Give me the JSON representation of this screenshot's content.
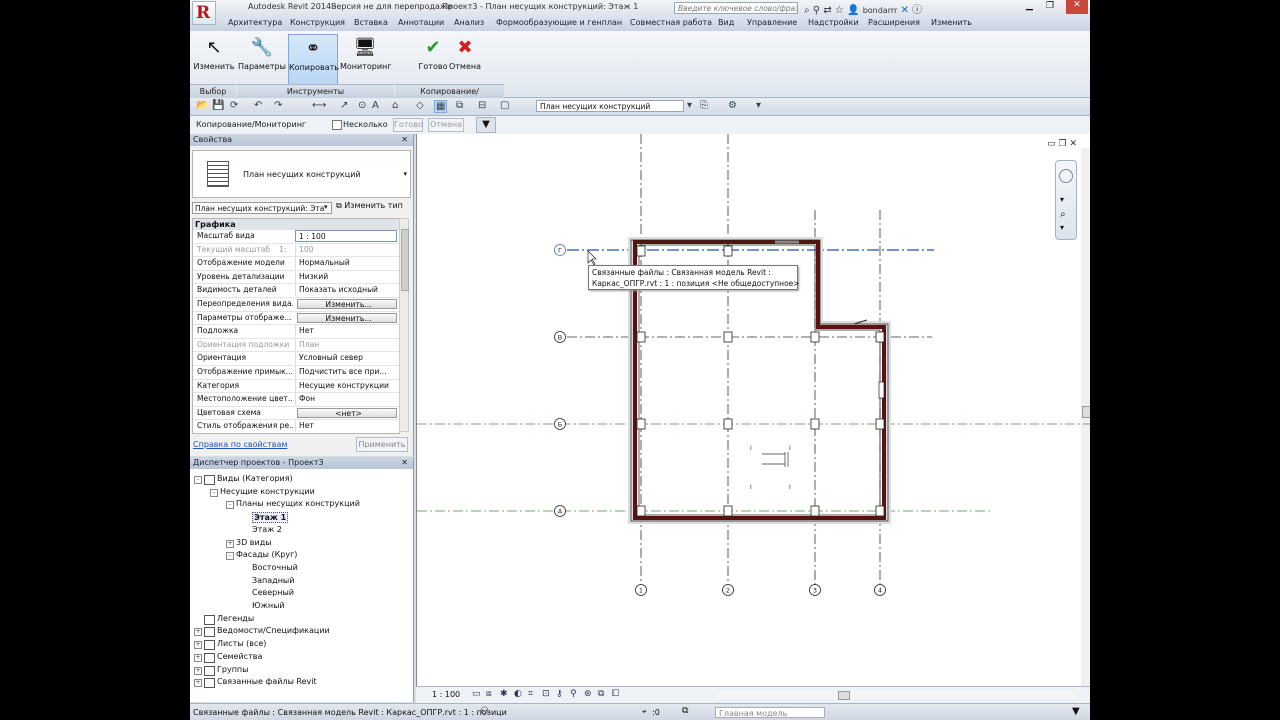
{
  "window": {
    "app_title": "Autodesk Revit 2014 -",
    "license_notice": "Версия не для перепродажи",
    "document_title": "Проект3 - План несущих конструкций: Этаж 1",
    "search_placeholder": "Введите ключевое слово/фразу",
    "user": "bondarrr"
  },
  "menu": [
    "Архитектура",
    "Конструкция",
    "Вставка",
    "Аннотации",
    "Анализ",
    "Формообразующие и генплан",
    "Совместная работа",
    "Вид",
    "Управление",
    "Надстройки",
    "Расширения",
    "Изменить"
  ],
  "ribbon": {
    "modify_label": "Изменить",
    "select_panel": "Выбор",
    "params_label": "Параметры",
    "copy_label": "Копировать",
    "monitor_label": "Мониторинг",
    "tools_panel": "Инструменты",
    "finish_label": "Готово",
    "cancel_label": "Отмена",
    "copymon_panel": "Копирование/Мониторинг"
  },
  "qat": {
    "view_combo": "План несущих конструкций"
  },
  "options_bar": {
    "context": "Копирование/Мониторинг",
    "multiple_label": "Несколько",
    "finish_btn": "Готово",
    "cancel_btn": "Отмена"
  },
  "properties": {
    "header": "Свойства",
    "type_name": "План несущих конструкций",
    "instance_selector": "План несущих конструкций: Эта",
    "edit_type": "Изменить тип",
    "group": "Графика",
    "rows": [
      {
        "key": "Масштаб вида",
        "value": "1 : 100",
        "kind": "input"
      },
      {
        "key": "Текущий масштаб",
        "value": "100",
        "kind": "disabled",
        "suffix": "1:"
      },
      {
        "key": "Отображение модели",
        "value": "Нормальный"
      },
      {
        "key": "Уровень детализации",
        "value": "Низкий"
      },
      {
        "key": "Видимость деталей",
        "value": "Показать исходный"
      },
      {
        "key": "Переопределения вида...",
        "value": "Изменить...",
        "kind": "button"
      },
      {
        "key": "Параметры отображе...",
        "value": "Изменить...",
        "kind": "button"
      },
      {
        "key": "Подложка",
        "value": "Нет"
      },
      {
        "key": "Ориентация подложки",
        "value": "План",
        "kind": "disabled"
      },
      {
        "key": "Ориентация",
        "value": "Условный север"
      },
      {
        "key": "Отображение примык...",
        "value": "Подчистить все при..."
      },
      {
        "key": "Категория",
        "value": "Несущие конструкции"
      },
      {
        "key": "Местоположение цвет...",
        "value": "Фон"
      },
      {
        "key": "Цветовая схема",
        "value": "<нет>",
        "kind": "button"
      },
      {
        "key": "Стиль отображения ре...",
        "value": "Нет"
      },
      {
        "key": "Траектория солнца",
        "value": "",
        "kind": "checkbox"
      }
    ],
    "help_link": "Справка по свойствам",
    "apply": "Применить"
  },
  "browser": {
    "header": "Диспетчер проектов - Проект3",
    "items": [
      {
        "label": "Виды (Категория)",
        "level": 0,
        "toggle": "-",
        "icon": "views-icon"
      },
      {
        "label": "Несущие конструкции",
        "level": 1,
        "toggle": "-"
      },
      {
        "label": "Планы несущих конструкций",
        "level": 2,
        "toggle": "-"
      },
      {
        "label": "Этаж 1",
        "level": 3,
        "bold": true
      },
      {
        "label": "Этаж 2",
        "level": 3
      },
      {
        "label": "3D виды",
        "level": 2,
        "toggle": "+"
      },
      {
        "label": "Фасады (Круг)",
        "level": 2,
        "toggle": "-"
      },
      {
        "label": "Восточный",
        "level": 3
      },
      {
        "label": "Западный",
        "level": 3
      },
      {
        "label": "Северный",
        "level": 3
      },
      {
        "label": "Южный",
        "level": 3
      },
      {
        "label": "Легенды",
        "level": 0,
        "icon": "legend-icon"
      },
      {
        "label": "Ведомости/Спецификации",
        "level": 0,
        "toggle": "+",
        "icon": "schedule-icon"
      },
      {
        "label": "Листы (все)",
        "level": 0,
        "toggle": "+",
        "icon": "sheet-icon"
      },
      {
        "label": "Семейства",
        "level": 0,
        "toggle": "+",
        "icon": "family-icon"
      },
      {
        "label": "Группы",
        "level": 0,
        "toggle": "+",
        "icon": "group-icon"
      },
      {
        "label": "Связанные файлы Revit",
        "level": 0,
        "toggle": "+",
        "icon": "link-icon"
      }
    ]
  },
  "drawing": {
    "grid_row_labels": [
      "Г",
      "В",
      "Б",
      "А"
    ],
    "grid_col_labels": [
      "1",
      "2",
      "3",
      "4"
    ],
    "tooltip_line1": "Связанные файлы : Связанная модель Revit :",
    "tooltip_line2": "Каркас_ОПГР.rvt : 1 : позиция <Не общедоступное>"
  },
  "view_control": {
    "scale": "1 : 100"
  },
  "status": {
    "text": "Связанные файлы : Связанная модель Revit : Каркас_ОПГР.rvt : 1 : позици",
    "filter_count": ":0",
    "model": "Главная модель"
  },
  "colors": {
    "wall": "#5a1210",
    "grid": "#333333",
    "accent_active": "#b8d6f5",
    "link_blue": "#1f56b6"
  }
}
